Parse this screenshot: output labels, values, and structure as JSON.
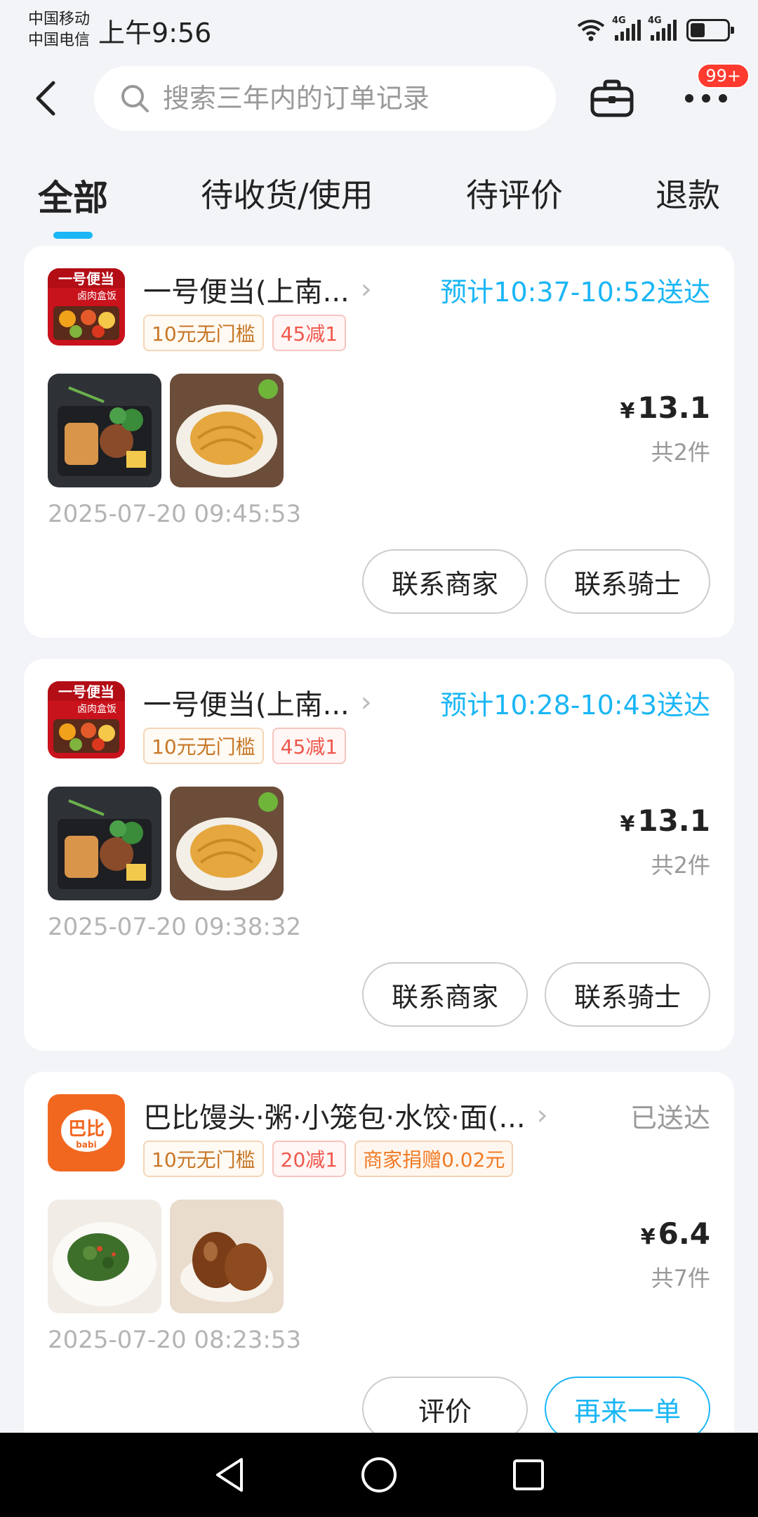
{
  "status_bar": {
    "carrier1": "中国移动",
    "carrier2": "中国电信",
    "time": "上午9:56",
    "network1": "4G",
    "network2": "4G"
  },
  "header": {
    "search_placeholder": "搜索三年内的订单记录",
    "more_badge": "99+"
  },
  "tabs": [
    {
      "label": "全部",
      "active": true
    },
    {
      "label": "待收货/使用",
      "active": false
    },
    {
      "label": "待评价",
      "active": false
    },
    {
      "label": "退款",
      "active": false
    }
  ],
  "orders": [
    {
      "shop_name": "一号便当(上南...",
      "status": "预计10:37-10:52送达",
      "tags": [
        "10元无门槛",
        "45减1"
      ],
      "price_symbol": "¥",
      "price": "13.1",
      "count": "共2件",
      "date": "2025-07-20 09:45:53",
      "buttons": [
        "联系商家",
        "联系骑士"
      ]
    },
    {
      "shop_name": "一号便当(上南...",
      "status": "预计10:28-10:43送达",
      "tags": [
        "10元无门槛",
        "45减1"
      ],
      "price_symbol": "¥",
      "price": "13.1",
      "count": "共2件",
      "date": "2025-07-20 09:38:32",
      "buttons": [
        "联系商家",
        "联系骑士"
      ]
    },
    {
      "shop_name": "巴比馒头·粥·小笼包·水饺·面(...",
      "status": "已送达",
      "tags": [
        "10元无门槛",
        "20减1",
        "商家捐赠0.02元"
      ],
      "price_symbol": "¥",
      "price": "6.4",
      "count": "共7件",
      "date": "2025-07-20 08:23:53",
      "buttons": [
        "评价",
        "再来一单"
      ]
    }
  ],
  "logos": {
    "bento_line1": "一号便当",
    "bento_line2": "卤肉盒饭",
    "babi": "巴比",
    "babi_sub": "babi"
  },
  "colors": {
    "accent": "#1ab6f5",
    "badge": "#ff3b30",
    "babi_orange": "#f2671f"
  }
}
